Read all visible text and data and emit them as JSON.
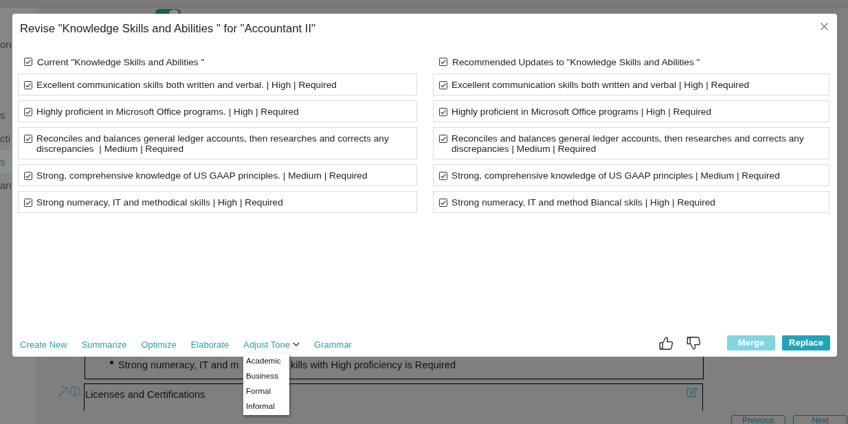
{
  "background": {
    "toggle": {
      "on": true
    },
    "sidebar": [
      {
        "label": "on",
        "selected": false
      },
      {
        "label": "s",
        "selected": false
      },
      {
        "label": "cti",
        "selected": false
      },
      {
        "label": "s",
        "selected": true
      },
      {
        "label": "an",
        "selected": false
      }
    ],
    "sections": [
      {
        "kind": "list",
        "fragments": [
          "Strong numeracy, IT and m",
          "kills with High proficiency is Required"
        ]
      },
      {
        "kind": "titled",
        "title": "Licenses and Certifications"
      }
    ],
    "nav_buttons": [
      "Previous",
      "Next"
    ]
  },
  "dialog": {
    "title": "Revise \"Knowledge Skills and Abilities \" for \"Accountant II\"",
    "columns": [
      {
        "header": {
          "label": "Current \"Knowledge Skills and Abilities \"",
          "checked": true
        },
        "items": [
          {
            "text": "Excellent communication skills both written and verbal. | High | Required",
            "checked": true
          },
          {
            "text": "Highly proficient in Microsoft Office programs. | High | Required",
            "checked": true
          },
          {
            "text": "Reconciles and balances general ledger accounts, then researches and corrects any discrepancies  | Medium | Required",
            "checked": true
          },
          {
            "text": "Strong, comprehensive knowledge of US GAAP principles. | Medium | Required",
            "checked": true
          },
          {
            "text": "Strong numeracy, IT and methodical skills | High | Required",
            "checked": true
          }
        ]
      },
      {
        "header": {
          "label": "Recommended Updates to \"Knowledge Skills and Abilities \"",
          "checked": true
        },
        "items": [
          {
            "text": "Excellent communication skills both written and verbal | High | Required",
            "checked": true
          },
          {
            "text": "Highly proficient in Microsoft Office programs | High | Required",
            "checked": true
          },
          {
            "text": "Reconciles and balances general ledger accounts, then researches and corrects any discrepancies | Medium | Required",
            "checked": true
          },
          {
            "text": "Strong, comprehensive knowledge of US GAAP principles | Medium | Required",
            "checked": true
          },
          {
            "text": "Strong numeracy, IT and method Biancal skils | High | Required",
            "checked": true
          }
        ]
      }
    ],
    "actions": [
      {
        "label": "Create New",
        "kind": "link"
      },
      {
        "label": "Summarize",
        "kind": "link"
      },
      {
        "label": "Optimize",
        "kind": "link"
      },
      {
        "label": "Elaborate",
        "kind": "link"
      },
      {
        "label": "Adjust Tone",
        "kind": "dropdown",
        "expanded": true,
        "options": [
          "Academic",
          "Business",
          "Formal",
          "Informal"
        ]
      },
      {
        "label": "Grammar",
        "kind": "link"
      }
    ],
    "buttons": [
      {
        "label": "Merge",
        "disabled": true
      },
      {
        "label": "Replace",
        "disabled": false
      }
    ]
  }
}
